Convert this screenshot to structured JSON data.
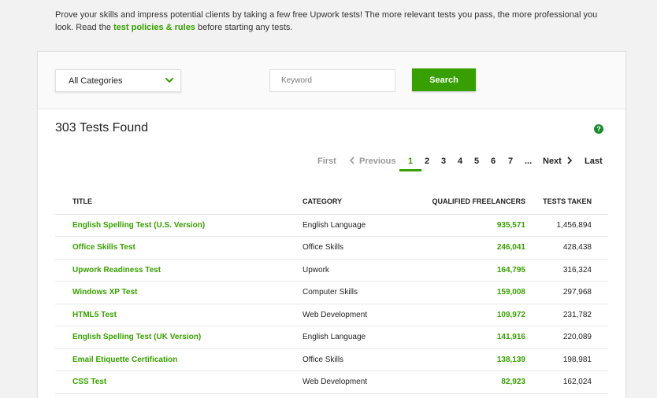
{
  "intro": {
    "text_before": "Prove your skills and impress potential clients by taking a few free Upwork tests! The more relevant tests you pass, the more professional you look. Read the ",
    "link": "test policies & rules",
    "text_after": " before starting any tests."
  },
  "filters": {
    "category_value": "All Categories",
    "keyword_placeholder": "Keyword",
    "search_label": "Search"
  },
  "results": {
    "title": "303 Tests Found",
    "help": "?"
  },
  "pagination": {
    "first": "First",
    "previous": "Previous",
    "pages": [
      "1",
      "2",
      "3",
      "4",
      "5",
      "6",
      "7"
    ],
    "ellipsis": "...",
    "next": "Next",
    "last": "Last",
    "current": "1"
  },
  "table": {
    "headers": {
      "title": "TITLE",
      "category": "CATEGORY",
      "qualified": "QUALIFIED FREELANCERS",
      "taken": "TESTS TAKEN"
    },
    "rows": [
      {
        "title": "English Spelling Test (U.S. Version)",
        "category": "English Language",
        "qualified": "935,571",
        "taken": "1,456,894"
      },
      {
        "title": "Office Skills Test",
        "category": "Office Skills",
        "qualified": "246,041",
        "taken": "428,438"
      },
      {
        "title": "Upwork Readiness Test",
        "category": "Upwork",
        "qualified": "164,795",
        "taken": "316,324"
      },
      {
        "title": "Windows XP Test",
        "category": "Computer Skills",
        "qualified": "159,008",
        "taken": "297,968"
      },
      {
        "title": "HTML5 Test",
        "category": "Web Development",
        "qualified": "109,972",
        "taken": "231,782"
      },
      {
        "title": "English Spelling Test (UK Version)",
        "category": "English Language",
        "qualified": "141,916",
        "taken": "220,089"
      },
      {
        "title": "Email Etiquette Certification",
        "category": "Office Skills",
        "qualified": "138,139",
        "taken": "198,981"
      },
      {
        "title": "CSS Test",
        "category": "Web Development",
        "qualified": "82,923",
        "taken": "162,024"
      }
    ]
  },
  "colors": {
    "accent": "#37a000",
    "help_icon": "#1a8c2d",
    "background": "#f2f2f2"
  }
}
